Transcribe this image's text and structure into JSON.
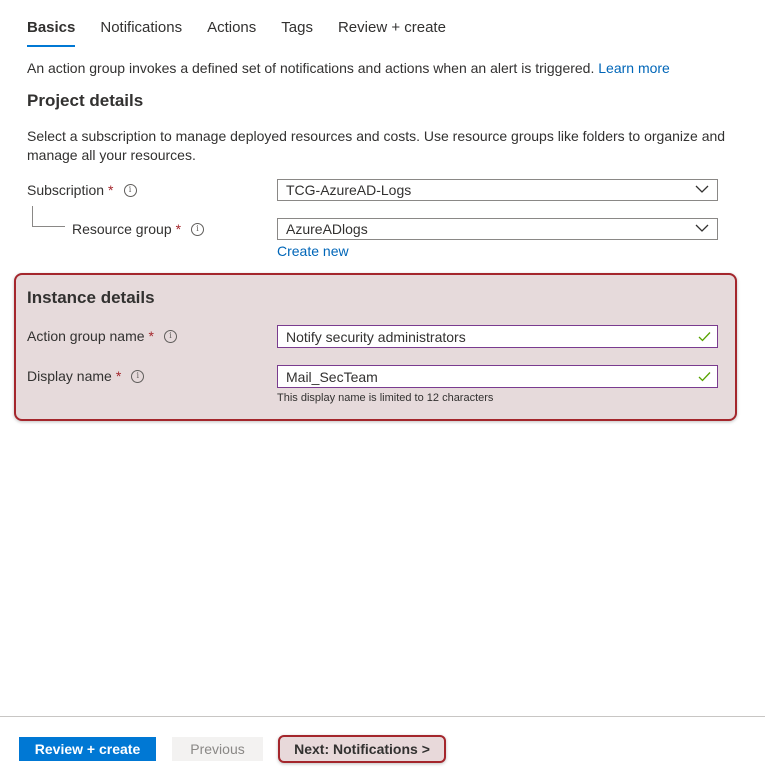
{
  "tabs": [
    {
      "label": "Basics"
    },
    {
      "label": "Notifications"
    },
    {
      "label": "Actions"
    },
    {
      "label": "Tags"
    },
    {
      "label": "Review + create"
    }
  ],
  "intro": {
    "text": "An action group invokes a defined set of notifications and actions when an alert is triggered.",
    "link": "Learn more"
  },
  "project": {
    "heading": "Project details",
    "description": "Select a subscription to manage deployed resources and costs. Use resource groups like folders to organize and manage all your resources.",
    "subscription_label": "Subscription",
    "subscription_value": "TCG-AzureAD-Logs",
    "resource_group_label": "Resource group",
    "resource_group_value": "AzureADlogs",
    "create_new": "Create new"
  },
  "instance": {
    "heading": "Instance details",
    "action_group_label": "Action group name",
    "action_group_value": "Notify security administrators",
    "display_name_label": "Display name",
    "display_name_value": "Mail_SecTeam",
    "display_name_hint": "This display name is limited to 12 characters"
  },
  "footer": {
    "review_create": "Review + create",
    "previous": "Previous",
    "next": "Next: Notifications >"
  },
  "required_marker": "*",
  "info_glyph": "i",
  "colors": {
    "accent": "#0078d4",
    "link": "#0066b8",
    "required": "#a4262c",
    "highlight_border": "#a4262c",
    "highlight_fill": "#e6dadb",
    "valid_check": "#57a300"
  }
}
